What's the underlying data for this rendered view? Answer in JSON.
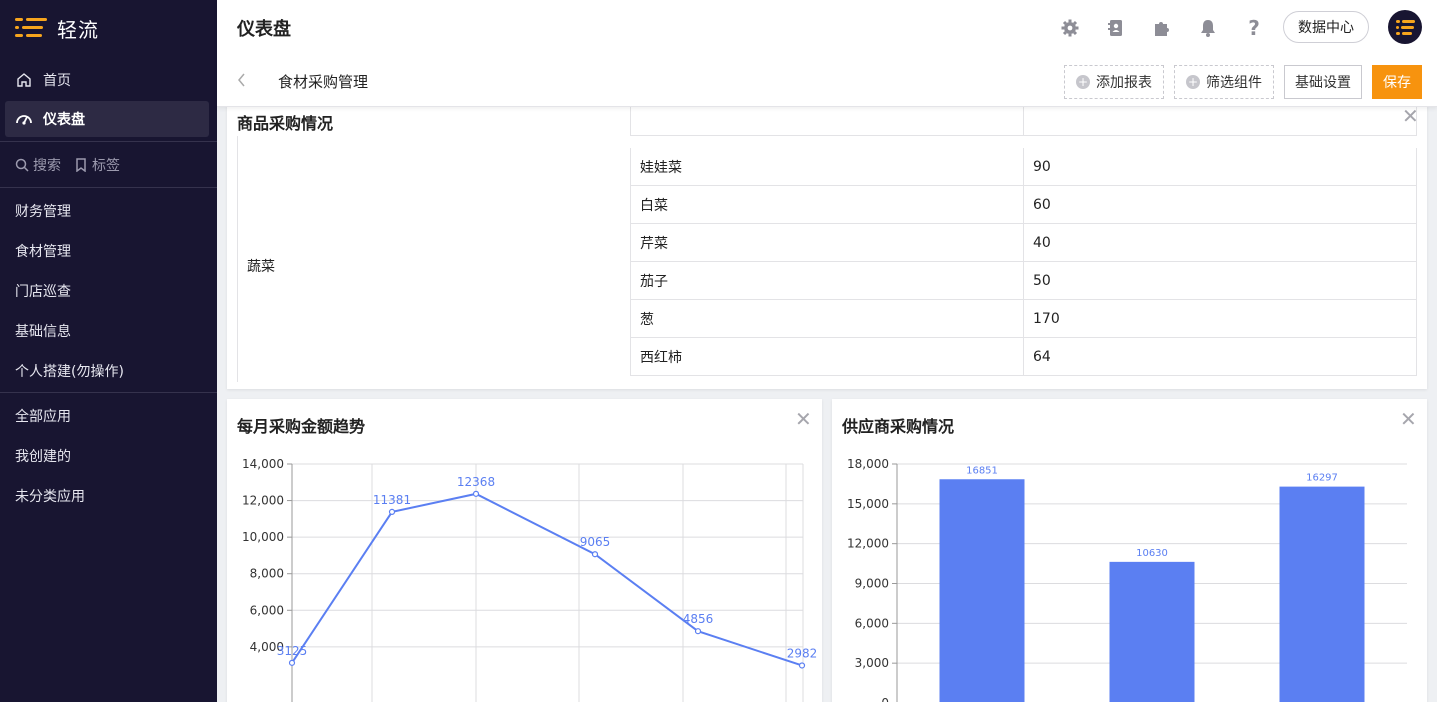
{
  "app": {
    "name": "轻流"
  },
  "sidebar": {
    "primary": [
      {
        "label": "首页",
        "icon": "home-icon"
      },
      {
        "label": "仪表盘",
        "icon": "dashboard-icon",
        "active": true
      }
    ],
    "search_label": "搜索",
    "tags_label": "标签",
    "groups": [
      "财务管理",
      "食材管理",
      "门店巡查",
      "基础信息",
      "个人搭建(勿操作)"
    ],
    "apps": [
      "全部应用",
      "我创建的",
      "未分类应用"
    ]
  },
  "header": {
    "title": "仪表盘",
    "data_center": "数据中心",
    "icons": [
      "gear-icon",
      "contacts-icon",
      "plugin-icon",
      "bell-icon",
      "help-icon"
    ]
  },
  "toolbar": {
    "dashboard_name": "食材采购管理",
    "add_report": "添加报表",
    "filter_widget": "筛选组件",
    "basic_settings": "基础设置",
    "save": "保存"
  },
  "table_card": {
    "title": "商品采购情况",
    "category": "蔬菜",
    "rows": [
      {
        "item": "娃娃菜",
        "qty": "90"
      },
      {
        "item": "白菜",
        "qty": "60"
      },
      {
        "item": "芹菜",
        "qty": "40"
      },
      {
        "item": "茄子",
        "qty": "50"
      },
      {
        "item": "葱",
        "qty": "170"
      },
      {
        "item": "西红柿",
        "qty": "64"
      }
    ]
  },
  "line_card": {
    "title": "每月采购金额趋势"
  },
  "bar_card": {
    "title": "供应商采购情况"
  },
  "colors": {
    "accent": "#f7930e",
    "sidebar_bg": "#181531",
    "chart_blue": "#5b7ff2"
  },
  "chart_data": [
    {
      "type": "line",
      "title": "每月采购金额趋势",
      "values": [
        3125,
        11381,
        12368,
        9065,
        4856,
        2982
      ],
      "value_labels": [
        "3125",
        "11381",
        "12368",
        "9065",
        "4856",
        "2982"
      ],
      "y_ticks": [
        "4,000",
        "6,000",
        "8,000",
        "10,000",
        "12,000",
        "14,000"
      ],
      "ylim": [
        0,
        14000
      ],
      "grid": true
    },
    {
      "type": "bar",
      "title": "供应商采购情况",
      "values": [
        16851,
        10630,
        16297
      ],
      "value_labels": [
        "16851",
        "10630",
        "16297"
      ],
      "y_ticks": [
        "0",
        "3,000",
        "6,000",
        "9,000",
        "12,000",
        "15,000",
        "18,000"
      ],
      "ylim": [
        0,
        18000
      ],
      "grid": true
    }
  ]
}
